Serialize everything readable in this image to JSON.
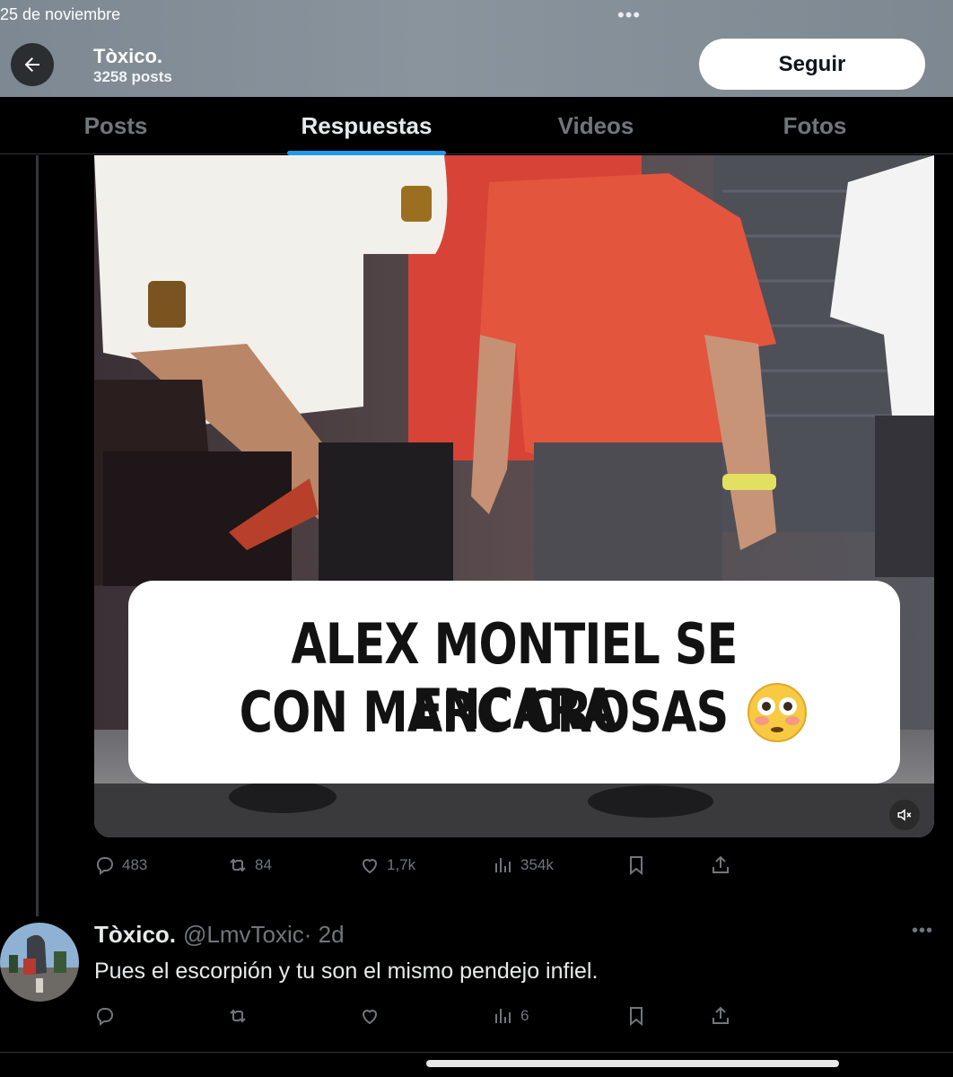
{
  "status_bar": {
    "date": "25 de noviembre",
    "dots": "•••"
  },
  "header": {
    "back_label": "←",
    "account_name": "Tòxico.",
    "post_count": "3258 posts",
    "follow_label": "Seguir"
  },
  "tabs": [
    {
      "label": "Posts",
      "active": false
    },
    {
      "label": "Respuestas",
      "active": true
    },
    {
      "label": "Videos",
      "active": false
    },
    {
      "label": "Fotos",
      "active": false
    }
  ],
  "post": {
    "video": {
      "caption_line1": "ALEX MONTIEL SE ENCARA",
      "caption_line2": "CON MARC CROSAS",
      "caption_emoji": "flushed-face",
      "mute_icon": "speaker-muted-icon"
    },
    "actions": {
      "replies": "483",
      "reposts": "84",
      "likes": "1,7k",
      "views": "354k"
    }
  },
  "reply": {
    "name": "Tòxico.",
    "handle": "@LmvToxic",
    "time": "· 2d",
    "more": "•••",
    "text": "Pues el escorpión y tu son el mismo pendejo infiel.",
    "actions": {
      "replies": "",
      "reposts": "",
      "likes": "",
      "views": "6"
    }
  },
  "colors": {
    "accent": "#1d9bf0",
    "header_bg": "#858f98",
    "muted_text": "#71767b",
    "primary_text": "#e7e9ea"
  }
}
